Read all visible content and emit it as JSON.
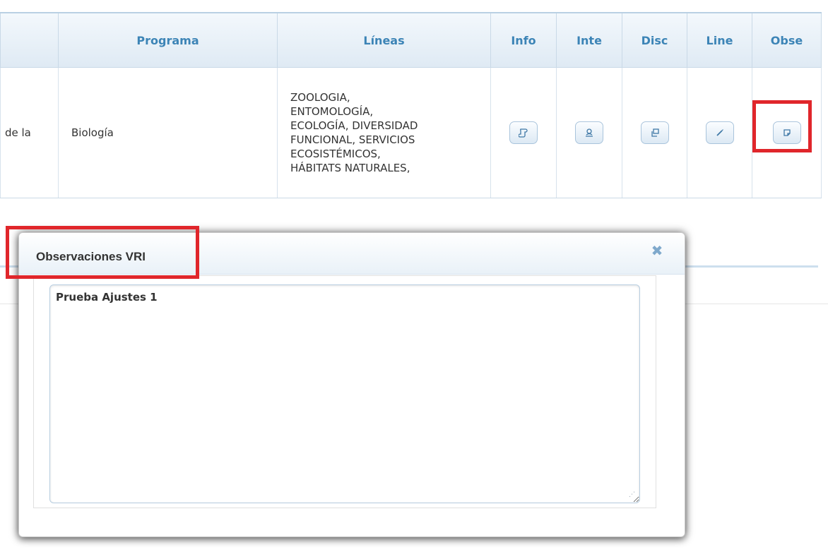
{
  "table": {
    "columns": [
      {
        "key": "prev",
        "label": ""
      },
      {
        "key": "programa",
        "label": "Programa"
      },
      {
        "key": "lineas",
        "label": "Líneas"
      },
      {
        "key": "info",
        "label": "Info"
      },
      {
        "key": "inte",
        "label": "Inte"
      },
      {
        "key": "disc",
        "label": "Disc"
      },
      {
        "key": "line",
        "label": "Line"
      },
      {
        "key": "obse",
        "label": "Obse"
      }
    ],
    "row": {
      "prev_text": "de la",
      "programa": "Biología",
      "lineas": [
        "ZOOLOGIA,",
        "ENTOMOLOGÍA,",
        "ECOLOGÍA, DIVERSIDAD",
        "FUNCIONAL, SERVICIOS",
        "ECOSISTÉMICOS,",
        "HÁBITATS NATURALES,"
      ],
      "actions": {
        "info_icon": "scroll-icon",
        "inte_icon": "user-icon",
        "disc_icon": "windows-icon",
        "line_icon": "pencil-icon",
        "obse_icon": "note-icon"
      }
    }
  },
  "dialog": {
    "title": "Observaciones VRI",
    "close_icon": "close-icon",
    "textarea_value": "Prueba Ajustes 1"
  },
  "colors": {
    "header_text": "#3c84b6",
    "highlight": "#e0262b",
    "close_icon": "#7fa9cc"
  }
}
